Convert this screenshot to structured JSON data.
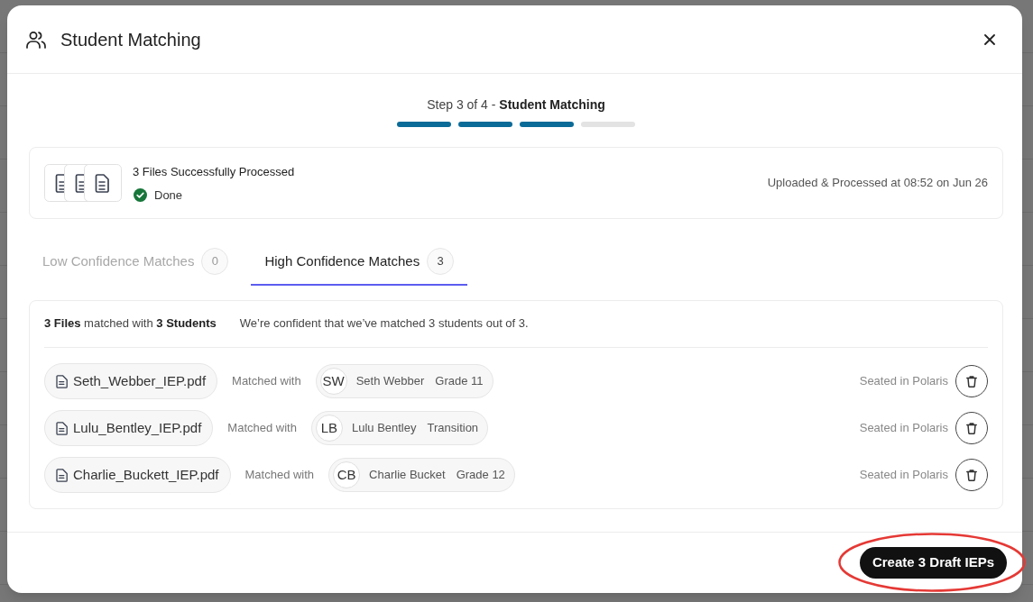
{
  "dialog": {
    "title": "Student Matching"
  },
  "stepper": {
    "label": "Step 3 of 4 - **Student Matching**",
    "segments": [
      {
        "complete": true
      },
      {
        "complete": true
      },
      {
        "complete": true
      },
      {
        "complete": false
      }
    ]
  },
  "upload_summary": {
    "title": "3 Files Successfully Processed",
    "status": {
      "kind": "done",
      "label": "Done"
    },
    "timestamp": "Uploaded & Processed at 08:52 on Jun 26"
  },
  "tabs": [
    {
      "label": "Low Confidence Matches",
      "count": "0",
      "selected": false
    },
    {
      "label": "High Confidence Matches",
      "count": "3",
      "selected": true
    }
  ],
  "matches": {
    "summary": "**3 Files** matched with **3 Students**",
    "note": "We’re confident that we’ve matched 3 students out of 3.",
    "rows": [
      {
        "file": "Seth_Webber_IEP.pdf",
        "link_label": "Matched with",
        "initials": "SW",
        "student": "Seth Webber",
        "grade": "Grade 11",
        "seat": "Seated in Polaris"
      },
      {
        "file": "Lulu_Bentley_IEP.pdf",
        "link_label": "Matched with",
        "initials": "LB",
        "student": "Lulu Bentley",
        "grade": "Transition",
        "seat": "Seated in Polaris"
      },
      {
        "file": "Charlie_Buckett_IEP.pdf",
        "link_label": "Matched with",
        "initials": "CB",
        "student": "Charlie Bucket",
        "grade": "Grade 12",
        "seat": "Seated in Polaris"
      }
    ]
  },
  "footer": {
    "primary_button": {
      "label": "Create 3 Draft IEPs",
      "highlighted": true
    }
  }
}
